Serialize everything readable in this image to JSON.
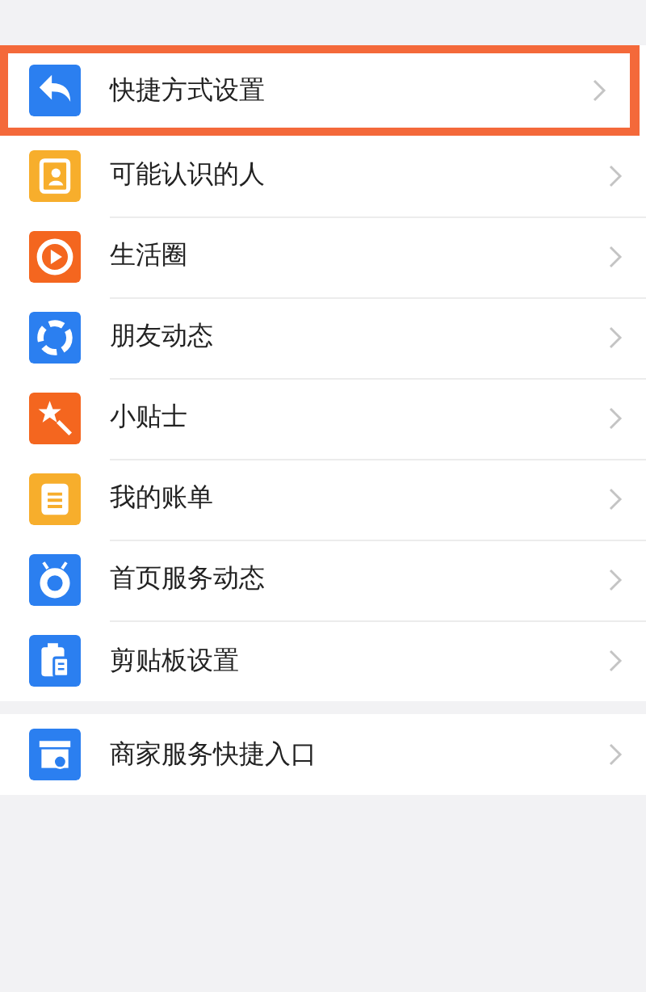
{
  "groups": [
    {
      "items": [
        {
          "label": "快捷方式设置",
          "kind": "reply",
          "color": "#2b7ff0",
          "highlighted": true
        },
        {
          "label": "可能认识的人",
          "kind": "contact",
          "color": "#f7ae2c",
          "highlighted": false
        },
        {
          "label": "生活圈",
          "kind": "play",
          "color": "#f4661f",
          "highlighted": false
        },
        {
          "label": "朋友动态",
          "kind": "aperture",
          "color": "#2b7ff0",
          "highlighted": false
        },
        {
          "label": "小贴士",
          "kind": "wand",
          "color": "#f4661f",
          "highlighted": false
        },
        {
          "label": "我的账单",
          "kind": "list",
          "color": "#f7ae2c",
          "highlighted": false
        },
        {
          "label": "首页服务动态",
          "kind": "ring",
          "color": "#2b7ff0",
          "highlighted": false
        },
        {
          "label": "剪贴板设置",
          "kind": "clipboard",
          "color": "#2b7ff0",
          "highlighted": false
        }
      ]
    },
    {
      "items": [
        {
          "label": "商家服务快捷入口",
          "kind": "store",
          "color": "#2b7ff0",
          "highlighted": false
        }
      ]
    }
  ]
}
